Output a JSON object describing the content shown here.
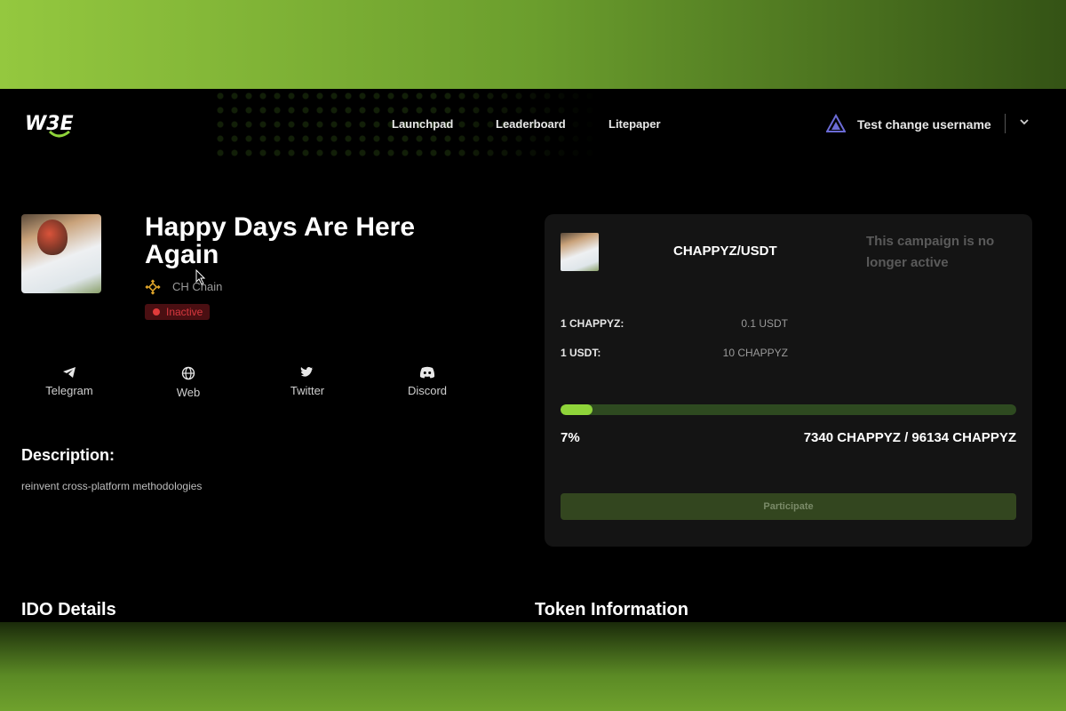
{
  "nav": {
    "logo_text": "W3E",
    "items": [
      {
        "label": "Launchpad"
      },
      {
        "label": "Leaderboard"
      },
      {
        "label": "Litepaper"
      }
    ],
    "user": {
      "name": "Test change username",
      "icon": "triangle-logo-icon"
    }
  },
  "project": {
    "title": "Happy Days Are Here Again",
    "chain": "CH Chain",
    "chain_icon": "bnb-chain-icon",
    "status": "Inactive"
  },
  "socials": [
    {
      "label": "Telegram",
      "icon": "telegram-icon"
    },
    {
      "label": "Web",
      "icon": "globe-icon"
    },
    {
      "label": "Twitter",
      "icon": "twitter-icon"
    },
    {
      "label": "Discord",
      "icon": "discord-icon"
    }
  ],
  "description": {
    "heading": "Description:",
    "text": "reinvent cross-platform methodologies"
  },
  "sections": {
    "ido_details": "IDO Details",
    "token_information": "Token Information"
  },
  "sale_card": {
    "pair": "CHAPPYZ/USDT",
    "inactive_message": "This campaign is no longer active",
    "rates": [
      {
        "label": "1 CHAPPYZ:",
        "value": "0.1 USDT"
      },
      {
        "label": "1 USDT:",
        "value": "10 CHAPPYZ"
      }
    ],
    "progress_percent": 7,
    "progress_label": "7%",
    "amounts": "7340 CHAPPYZ / 96134 CHAPPYZ",
    "participate_label": "Participate"
  },
  "colors": {
    "accent_green": "#8fd43a",
    "inactive_red": "#d8383f",
    "card_bg": "#141414"
  }
}
